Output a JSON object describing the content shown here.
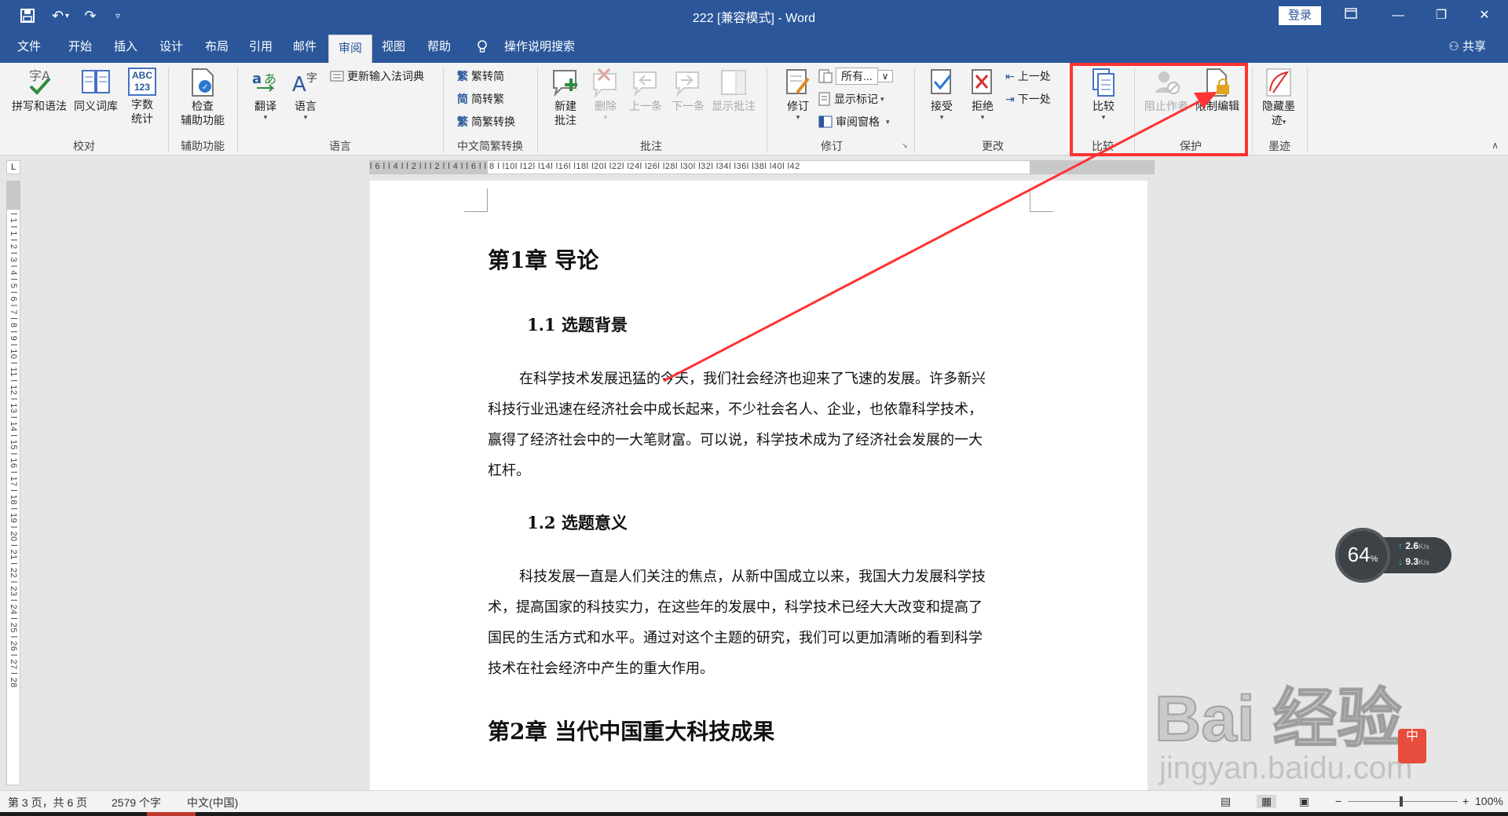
{
  "window": {
    "title": "222 [兼容模式]  -  Word",
    "login_label": "登录",
    "share_label": "共享"
  },
  "tabs": [
    {
      "label": "文件"
    },
    {
      "label": "开始"
    },
    {
      "label": "插入"
    },
    {
      "label": "设计"
    },
    {
      "label": "布局"
    },
    {
      "label": "引用"
    },
    {
      "label": "邮件"
    },
    {
      "label": "审阅",
      "active": true
    },
    {
      "label": "视图"
    },
    {
      "label": "帮助"
    },
    {
      "label": "操作说明搜索"
    }
  ],
  "ribbon": {
    "proofing": {
      "group": "校对",
      "spelling": "拼写和语法",
      "thesaurus": "同义词库",
      "wordcount_icon": "ABC 123",
      "wordcount_line1": "字数",
      "wordcount_line2": "统计"
    },
    "accessibility": {
      "group": "辅助功能",
      "check_line1": "检查",
      "check_line2": "辅助功能"
    },
    "language": {
      "group": "语言",
      "translate": "翻译",
      "language": "语言",
      "update_ime": "更新输入法词典"
    },
    "chinese": {
      "group": "中文简繁转换",
      "to_simplified": "繁转简",
      "to_traditional": "简转繁",
      "convert": "简繁转换"
    },
    "comments": {
      "group": "批注",
      "new_line1": "新建",
      "new_line2": "批注",
      "delete": "删除",
      "previous": "上一条",
      "next": "下一条",
      "show": "显示批注"
    },
    "tracking": {
      "group": "修订",
      "track": "修订",
      "all_markup": "所有...",
      "show_markup": "显示标记",
      "review_pane": "审阅窗格"
    },
    "changes": {
      "group": "更改",
      "accept": "接受",
      "reject": "拒绝",
      "previous": "上一处",
      "next": "下一处"
    },
    "compare": {
      "group": "比较",
      "compare": "比较"
    },
    "protect": {
      "group": "保护",
      "block_authors": "阻止作者",
      "restrict_editing": "限制编辑"
    },
    "ink": {
      "group": "墨迹",
      "hide_line1": "隐藏墨",
      "hide_line2": "迹"
    }
  },
  "rulers": {
    "horizontal": "l 6 l l 4 l l 2 l  l  l 2 l l 4 l l 6 l l 8 l l10l l12l l14l l16l l18l l20l l22l l24l l26l l28l l30l l32l l34l l36l l38l l40l l42",
    "vertical": "l 1 l 1 l 2 l 3 l 4 l 5 l 6 l 7 l 8 l 9 l 10 l 11 l 12 l 13 l 14 l 15 l 16 l 17 l 18 l 19 l 20 l 21 l 22 l 23 l 24 l 25 l 26 l 27 l 28"
  },
  "document": {
    "chapter1": "第1章    导论",
    "sec1_1": "1.1 选题背景",
    "para1": [
      "在科学技术发展迅猛的今天，我们社会经济也迎来了飞速的发展。许多新兴",
      "科技行业迅速在经济社会中成长起来，不少社会名人、企业，也依靠科学技术，",
      "赢得了经济社会中的一大笔财富。可以说，科学技术成为了经济社会发展的一大",
      "杠杆。"
    ],
    "sec1_2": "1.2 选题意义",
    "para2": [
      "科技发展一直是人们关注的焦点，从新中国成立以来，我国大力发展科学技",
      "术，提高国家的科技实力，在这些年的发展中，科学技术已经大大改变和提高了",
      "国民的生活方式和水平。通过对这个主题的研究，我们可以更加清晰的看到科学",
      "技术在社会经济中产生的重大作用。"
    ],
    "chapter2": "第2章    当代中国重大科技成果"
  },
  "statusbar": {
    "page": "第 3 页，共 6 页",
    "words": "2579 个字",
    "language": "中文(中国)",
    "zoom_minus": "−",
    "zoom_plus": "+",
    "zoom": "100%"
  },
  "net_widget": {
    "percent": "64",
    "percent_sign": "%",
    "up": "2.6",
    "down": "9.3",
    "unit": "K/s"
  },
  "watermark": {
    "main": "Bai  经验",
    "sub": "jingyan.baidu.com",
    "badge": "中"
  },
  "colors": {
    "accent": "#2b579a",
    "highlight": "#ff3333",
    "ribbon_bg": "#f3f3f3"
  }
}
